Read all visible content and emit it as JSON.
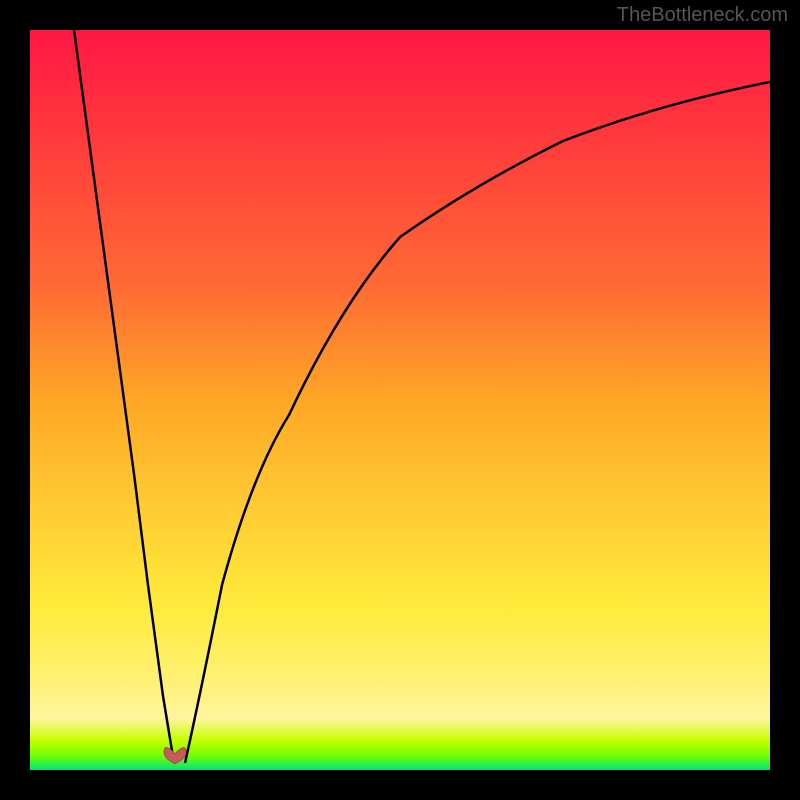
{
  "watermark": "TheBottleneck.com",
  "chart_data": {
    "type": "line",
    "title": "",
    "xlabel": "",
    "ylabel": "",
    "xlim": [
      0,
      100
    ],
    "ylim": [
      0,
      100
    ],
    "grid": false,
    "series": [
      {
        "name": "left-curve",
        "x": [
          6,
          8,
          10,
          12,
          14,
          16,
          18,
          19.5
        ],
        "y": [
          100,
          85,
          70,
          55,
          40,
          25,
          10,
          1
        ]
      },
      {
        "name": "right-curve",
        "x": [
          21,
          23,
          26,
          30,
          35,
          42,
          50,
          60,
          72,
          85,
          100
        ],
        "y": [
          1,
          10,
          25,
          40,
          52,
          63,
          72,
          79,
          85,
          90,
          93
        ]
      }
    ],
    "background_gradient": {
      "stops": [
        {
          "offset": 0,
          "color": "#ff1744"
        },
        {
          "offset": 15,
          "color": "#ff3b3b"
        },
        {
          "offset": 35,
          "color": "#ff6b35"
        },
        {
          "offset": 50,
          "color": "#ffa726"
        },
        {
          "offset": 65,
          "color": "#ffcc33"
        },
        {
          "offset": 78,
          "color": "#ffeb3b"
        },
        {
          "offset": 88,
          "color": "#fff176"
        },
        {
          "offset": 93,
          "color": "#fff59d"
        },
        {
          "offset": 96,
          "color": "#c6ff00"
        },
        {
          "offset": 98,
          "color": "#76ff03"
        },
        {
          "offset": 100,
          "color": "#00e676"
        }
      ]
    },
    "marker": {
      "x": 19.5,
      "y": 1,
      "shape": "heart",
      "color": "#c75b5b"
    }
  }
}
